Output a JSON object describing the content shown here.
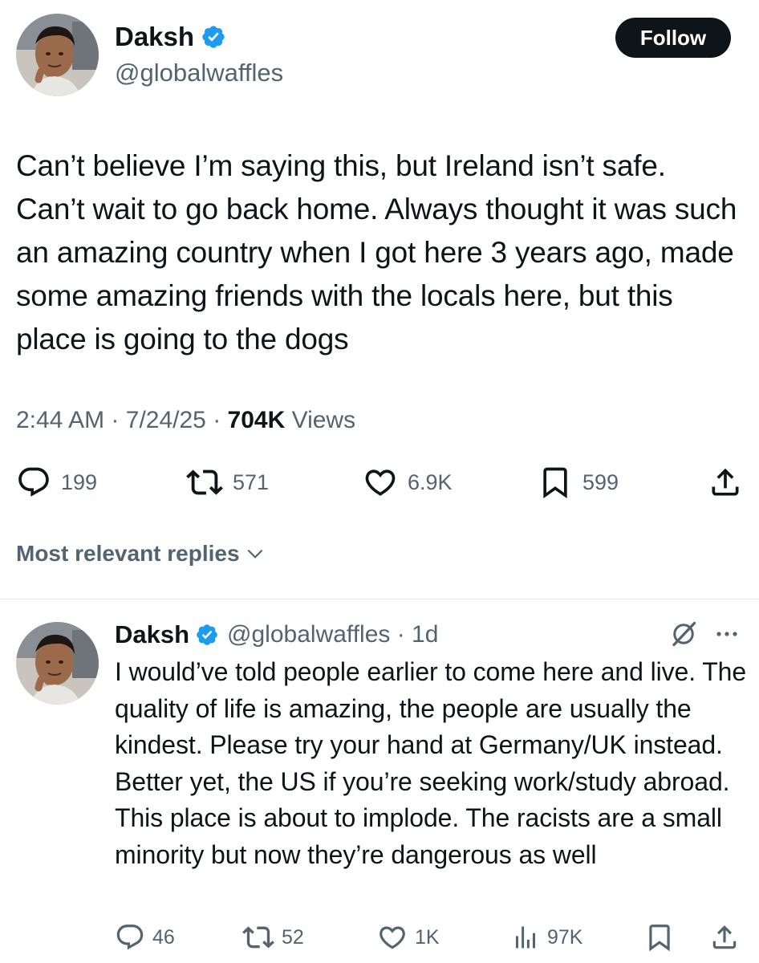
{
  "tweet": {
    "author": {
      "display_name": "Daksh",
      "handle": "@globalwaffles",
      "avatar_icon": "profile-photo"
    },
    "follow_label": "Follow",
    "text": "Can’t believe I’m saying this, but Ireland isn’t safe. Can’t wait to go back home. Always thought it was such an amazing country when I got here 3 years ago, made some amazing friends with the locals here, but this place is going to the dogs",
    "time": "2:44 AM",
    "date": "7/24/25",
    "separator": "·",
    "views_count": "704K",
    "views_label": "Views",
    "stats": {
      "replies": "199",
      "reposts": "571",
      "likes": "6.9K",
      "bookmarks": "599"
    }
  },
  "replies_sort_label": "Most relevant replies",
  "reply": {
    "author": {
      "display_name": "Daksh",
      "handle": "@globalwaffles",
      "age": "1d"
    },
    "handle_age": "@globalwaffles · 1d",
    "text": "I would’ve told people earlier to come here and live. The quality of life is amazing, the people are usually the kindest. Please try your hand at Germany/UK instead. Better yet, the US if you’re seeking work/study abroad. This place is about to implode. The racists are a small minority but now they’re dangerous as well",
    "stats": {
      "replies": "46",
      "reposts": "52",
      "likes": "1K",
      "views": "97K"
    }
  },
  "colors": {
    "text": "#0f1419",
    "muted": "#536471",
    "verified": "#1d9bf0",
    "divider": "#e1e6ea",
    "button": "#0f1419"
  },
  "icons": [
    "verified-badge-icon",
    "reply-icon",
    "repost-icon",
    "like-icon",
    "bookmark-icon",
    "share-icon",
    "chevron-down-icon",
    "grok-icon",
    "more-icon",
    "views-icon"
  ]
}
